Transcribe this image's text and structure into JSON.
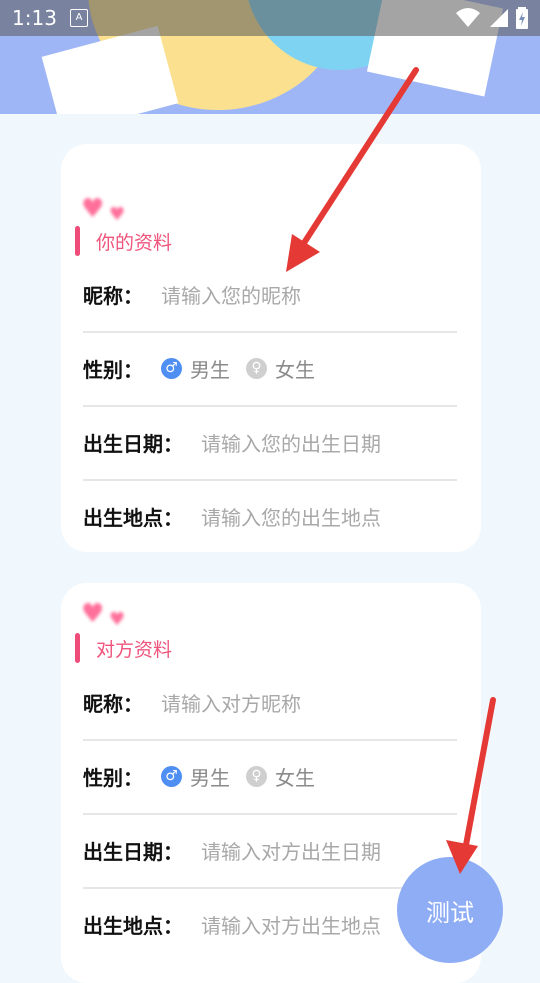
{
  "status_bar": {
    "time": "1:13",
    "notification_icon": "A"
  },
  "colors": {
    "accent_pink": "#ef557c",
    "radio_blue": "#4f8ef3",
    "test_button": "#8fadf5",
    "arrow_red": "#e53935"
  },
  "icons": [
    "wifi-icon",
    "signal-icon",
    "battery-icon",
    "heart-icon",
    "male-icon",
    "female-icon",
    "red-arrow"
  ],
  "your_profile": {
    "title": "你的资料",
    "nickname_label": "昵称：",
    "nickname_placeholder": "请输入您的昵称",
    "gender_label": "性别：",
    "gender_male": "男生",
    "gender_female": "女生",
    "birthdate_label": "出生日期：",
    "birthdate_placeholder": "请输入您的出生日期",
    "birthplace_label": "出生地点：",
    "birthplace_placeholder": "请输入您的出生地点"
  },
  "partner_profile": {
    "title": "对方资料",
    "nickname_label": "昵称：",
    "nickname_placeholder": "请输入对方昵称",
    "gender_label": "性别：",
    "gender_male": "男生",
    "gender_female": "女生",
    "birthdate_label": "出生日期：",
    "birthdate_placeholder": "请输入对方出生日期",
    "birthplace_label": "出生地点：",
    "birthplace_placeholder": "请输入对方出生地点"
  },
  "test_button": "测试"
}
